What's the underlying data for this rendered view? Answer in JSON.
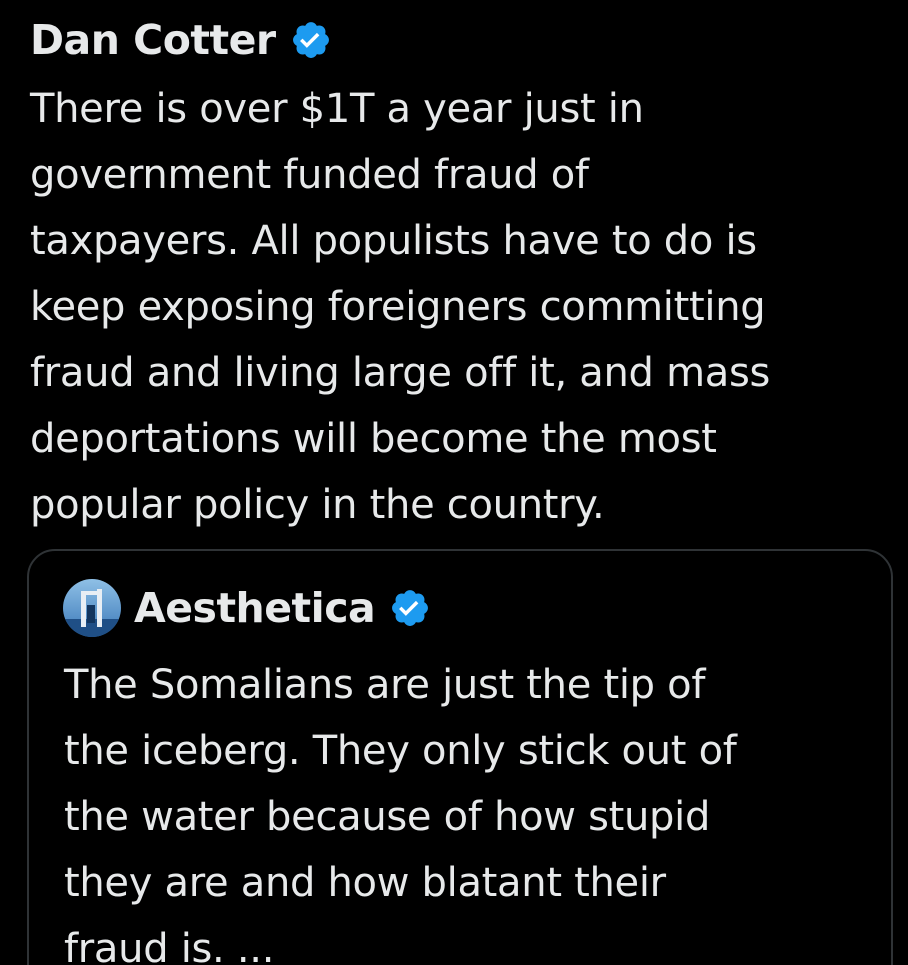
{
  "post": {
    "author_name": "Dan Cotter",
    "verified_icon": "verified-badge-icon",
    "text_lines": [
      "There is over $1T a year just in",
      "government funded fraud of",
      "taxpayers. All populists have to do is",
      "keep exposing foreigners committing",
      "fraud and living large off it, and mass",
      "deportations will become the most",
      "popular policy in the country."
    ]
  },
  "quote": {
    "author_name": "Aesthetica",
    "avatar_icon": "avatar-image",
    "verified_icon": "verified-badge-icon",
    "text_lines": [
      "The Somalians are just the tip of",
      "the iceberg. They only stick out of",
      "the water because of how stupid",
      "they are and how blatant their",
      "fraud is. ..."
    ]
  },
  "colors": {
    "background": "#000000",
    "text": "#e7e9ea",
    "verified_blue": "#1d9bf0",
    "card_border": "#2f3336"
  }
}
